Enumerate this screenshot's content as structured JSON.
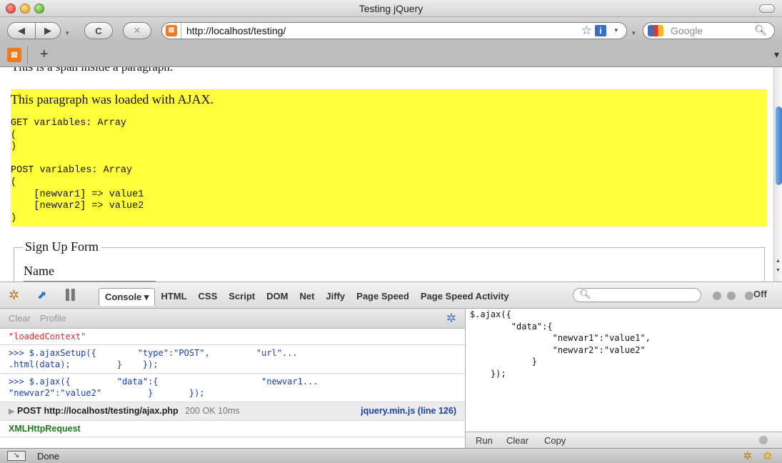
{
  "window": {
    "title": "Testing jQuery"
  },
  "toolbar": {
    "back_icon": "◀",
    "forward_icon": "▶",
    "reload_icon": "C",
    "stop_icon": "✕",
    "url": "http://localhost/testing/",
    "search_placeholder": "Google"
  },
  "page": {
    "partial_text": "This is a span inside a paragraph.",
    "ajax_paragraph": "This paragraph was loaded with AJAX.",
    "ajax_pre": "GET variables: Array\n(\n)\n\nPOST variables: Array\n(\n    [newvar1] => value1\n    [newvar2] => value2\n)",
    "form_legend": "Sign Up Form",
    "form_name_label": "Name"
  },
  "firebug": {
    "tabs": [
      "Console",
      "HTML",
      "CSS",
      "Script",
      "DOM",
      "Net",
      "Jiffy",
      "Page Speed",
      "Page Speed Activity"
    ],
    "off_label": "Off",
    "console_clear": "Clear",
    "console_profile": "Profile",
    "rows": {
      "loaded_context": "\"loadedContext\"",
      "cmd1": ">>> $.ajaxSetup({        \"type\":\"POST\",         \"url\"...\n.html(data);         }    });",
      "cmd2": ">>> $.ajax({         \"data\":{                    \"newvar1...\n\"newvar2\":\"value2\"         }       });",
      "post_label": "POST http://localhost/testing/ajax.php",
      "post_status": "200 OK 10ms",
      "post_source": "jquery.min.js (line 126)",
      "xhr": "XMLHttpRequest"
    },
    "editor_text": "$.ajax({\n        \"data\":{\n                \"newvar1\":\"value1\",\n                \"newvar2\":\"value2\"\n            }\n    });",
    "editor_run": "Run",
    "editor_clear": "Clear",
    "editor_copy": "Copy"
  },
  "status": {
    "text": "Done"
  },
  "colors": {
    "ajax_highlight": "#ffff3c",
    "error_red": "#d13030",
    "link_blue": "#1a3fa8",
    "xhr_green": "#1e7a1e"
  }
}
